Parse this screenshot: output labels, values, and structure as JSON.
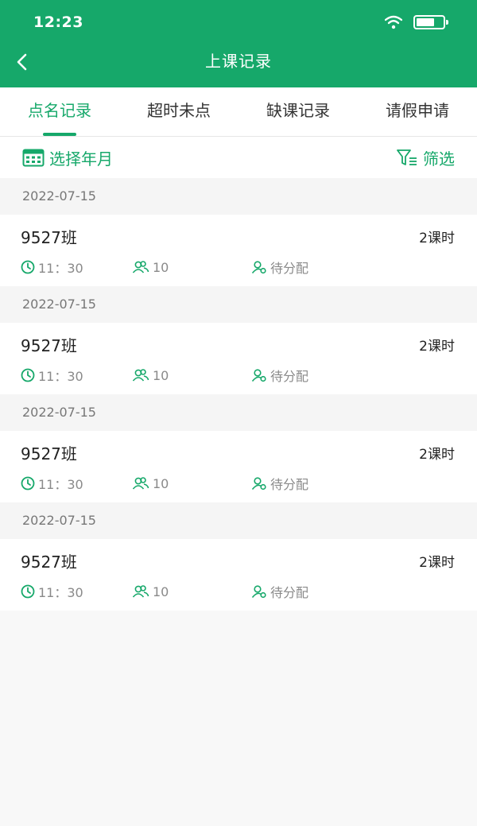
{
  "status_bar": {
    "time": "12:23"
  },
  "nav": {
    "title": "上课记录"
  },
  "tabs": [
    {
      "label": "点名记录",
      "active": true
    },
    {
      "label": "超时未点",
      "active": false
    },
    {
      "label": "缺课记录",
      "active": false
    },
    {
      "label": "请假申请",
      "active": false
    }
  ],
  "filter": {
    "date_picker_label": "选择年月",
    "filter_label": "筛选"
  },
  "records": [
    {
      "date": "2022-07-15",
      "class_name": "9527班",
      "hours": "2课时",
      "time": "11：30",
      "count": "10",
      "status": "待分配"
    },
    {
      "date": "2022-07-15",
      "class_name": "9527班",
      "hours": "2课时",
      "time": "11：30",
      "count": "10",
      "status": "待分配"
    },
    {
      "date": "2022-07-15",
      "class_name": "9527班",
      "hours": "2课时",
      "time": "11：30",
      "count": "10",
      "status": "待分配"
    },
    {
      "date": "2022-07-15",
      "class_name": "9527班",
      "hours": "2课时",
      "time": "11：30",
      "count": "10",
      "status": "待分配"
    }
  ],
  "colors": {
    "primary": "#16a86a",
    "text": "#222222",
    "muted": "#8a8a8a",
    "background": "#f8f8f8"
  },
  "icons": {
    "back": "back-arrow-icon",
    "calendar": "calendar-icon",
    "filter": "filter-icon",
    "time": "clock-icon",
    "students": "people-icon",
    "teacher": "teacher-icon"
  }
}
